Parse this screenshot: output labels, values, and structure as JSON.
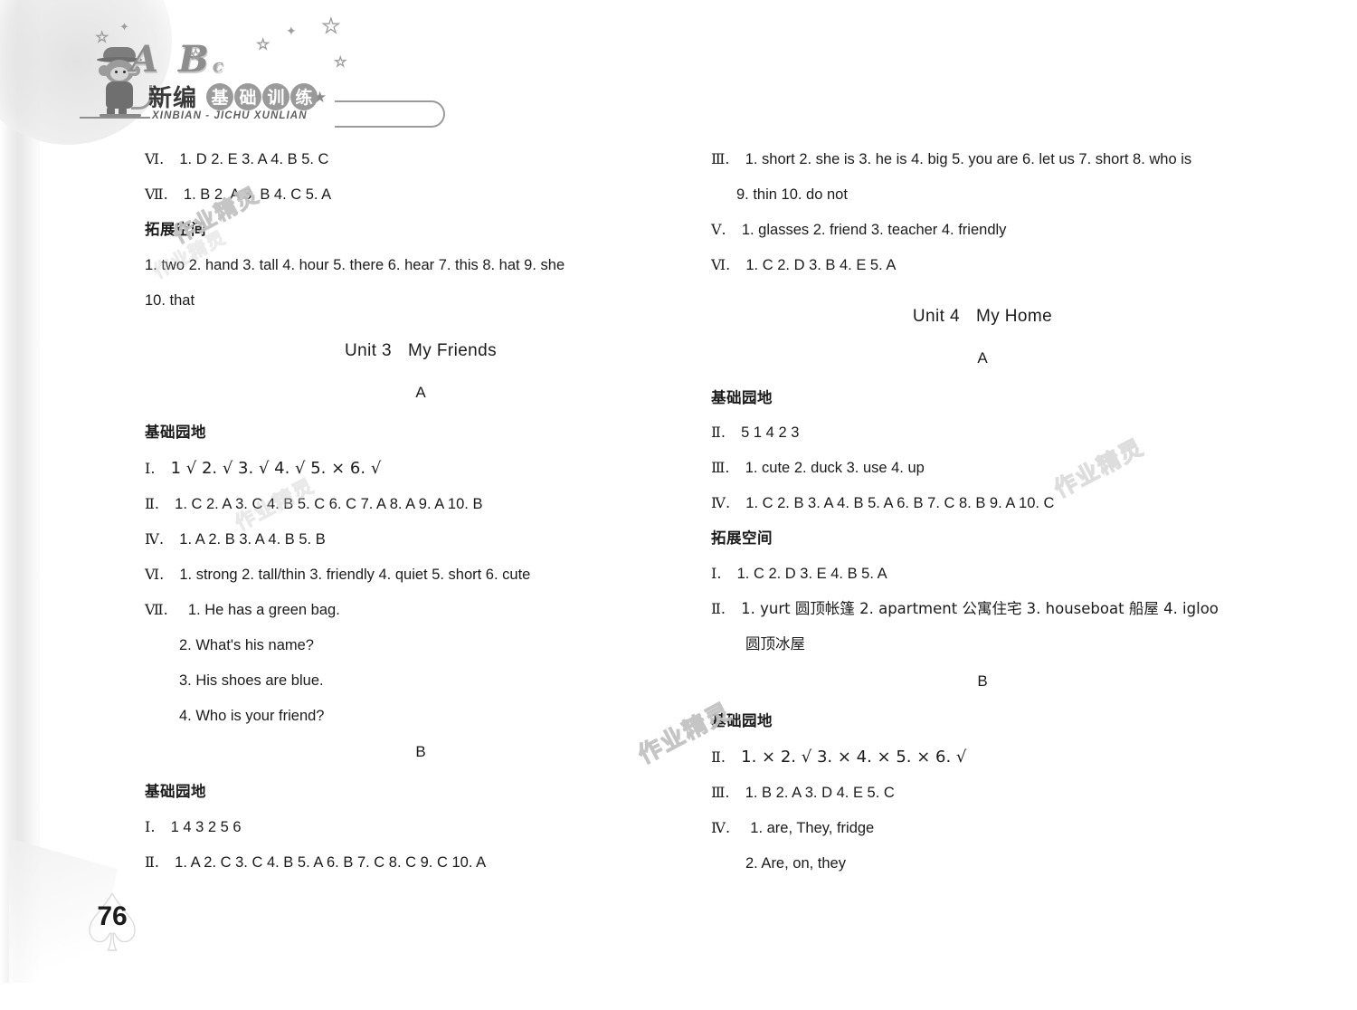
{
  "book": {
    "letters": "A B",
    "letters_small": "c",
    "title_plain": "新编",
    "title_pills": [
      "基",
      "础",
      "训",
      "练"
    ],
    "pinyin": "XINBIAN -  JICHU  XUNLIAN",
    "mascot": "monkey-mascot"
  },
  "page_number": "76",
  "watermark": "作业精灵",
  "left_column": {
    "top_answers": [
      {
        "num": "Ⅵ.",
        "text": "1. D   2. E   3. A   4. B   5. C"
      },
      {
        "num": "Ⅶ.",
        "text": "1. B   2. A   3. B   4. C   5. A"
      }
    ],
    "tuozhan_heading": "拓展空间",
    "tuozhan_rows": [
      "1. two   2. hand   3. tall   4. hour   5. there   6. hear   7. this   8. hat   9. she",
      "10. that"
    ],
    "unit": {
      "label": "Unit 3",
      "name": "My Friends",
      "section_a": "A",
      "section_b": "B"
    },
    "a_heading": "基础园地",
    "a_rows": [
      {
        "num": "Ⅰ.",
        "text": "1 √   2. √   3. √   4. √   5. ×   6. √"
      },
      {
        "num": "Ⅱ.",
        "text": "1. C  2. A  3. C  4. B  5. C  6. C  7. A  8. A  9. A  10. B"
      },
      {
        "num": "Ⅳ.",
        "text": "1. A   2. B   3. A   4. B   5. B"
      },
      {
        "num": "Ⅵ.",
        "text": "1. strong   2. tall/thin   3. friendly   4. quiet   5. short   6. cute"
      }
    ],
    "a_seven": {
      "num": "Ⅶ.",
      "lines": [
        "1. He has a green bag.",
        "2. What's his name?",
        "3.  His shoes are blue.",
        "4. Who is your friend?"
      ]
    },
    "b_heading": "基础园地",
    "b_rows": [
      {
        "num": "Ⅰ.",
        "text": "1   4   3   2   5   6"
      },
      {
        "num": "Ⅱ.",
        "text": "1. A   2. C   3. C   4. B   5. A   6. B   7. C   8. C   9. C   10. A"
      }
    ]
  },
  "right_column": {
    "top_answers": [
      {
        "num": "Ⅲ.",
        "text": "1. short   2. she is   3. he is   4. big   5. you are   6. let us   7. short   8. who is"
      },
      {
        "num": "",
        "text": "9. thin   10. do not",
        "indent": true
      },
      {
        "num": "Ⅴ.",
        "text": "1. glasses   2. friend   3. teacher   4. friendly"
      },
      {
        "num": "Ⅵ.",
        "text": "1. C   2. D   3. B   4. E   5. A"
      }
    ],
    "unit": {
      "label": "Unit 4",
      "name": "My Home",
      "section_a": "A",
      "section_b": "B"
    },
    "a_heading": "基础园地",
    "a_rows": [
      {
        "num": "Ⅱ.",
        "text": "5   1   4   2   3"
      },
      {
        "num": "Ⅲ.",
        "text": "1. cute   2. duck   3. use   4. up"
      },
      {
        "num": "Ⅳ.",
        "text": "1. C   2. B   3. A   4. B   5. A   6. B   7. C   8. B   9. A   10. C"
      }
    ],
    "tuozhan_heading": "拓展空间",
    "tuozhan_rows": [
      {
        "num": "Ⅰ.",
        "text": "1. C   2. D   3. E   4. B   5. A"
      },
      {
        "num": "Ⅱ.",
        "text": "1. yurt   圆顶帐篷   2. apartment   公寓住宅   3. houseboat   船屋   4. igloo"
      },
      {
        "num": "",
        "text": "圆顶冰屋",
        "indent": true
      }
    ],
    "b_heading": "基础园地",
    "b_rows": [
      {
        "num": "Ⅱ.",
        "text": "1. ×   2. √   3. ×   4. ×   5. ×   6. √"
      },
      {
        "num": "Ⅲ.",
        "text": "1. B   2. A   3. D   4. E   5. C"
      }
    ],
    "b_four": {
      "num": "Ⅳ.",
      "lines": [
        "1. are, They, fridge",
        "2. Are, on, they"
      ]
    }
  }
}
